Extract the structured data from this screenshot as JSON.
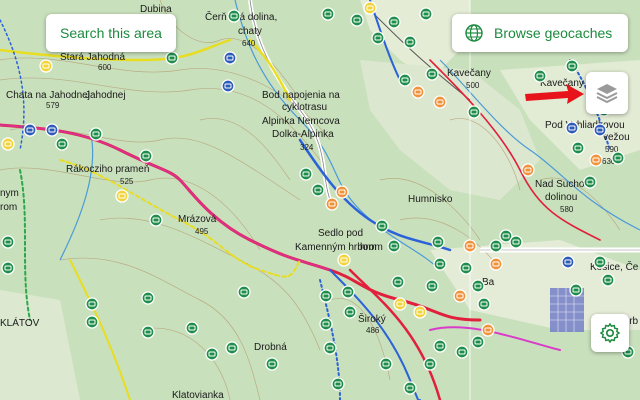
{
  "buttons": {
    "search_label": "Search this area",
    "browse_label": "Browse geocaches"
  },
  "icons": {
    "globe": "globe-icon",
    "layers": "layers-icon",
    "settings": "gear-icon",
    "arrow": "red-arrow-pointer"
  },
  "map": {
    "places": [
      {
        "text": "Dubina",
        "cls": "italic"
      },
      {
        "text": "Čerň   ská dolina,"
      },
      {
        "text": "chaty"
      },
      {
        "text": "Stará Jahodná"
      },
      {
        "text": "Chata na Jahodnej"
      },
      {
        "text": "Bod napojenia na"
      },
      {
        "text": "cyklotrasu"
      },
      {
        "text": "Alpinka Nemcova"
      },
      {
        "text": "Dolka-Alpinka"
      },
      {
        "text": "Kavečany"
      },
      {
        "text": "Kavečany",
        "cls": "italic"
      },
      {
        "text": "Pod Vyhliadkovou"
      },
      {
        "text": "vežou"
      },
      {
        "text": "Rákocziho prameň"
      },
      {
        "text": "Humnisko"
      },
      {
        "text": "Nad Suchou"
      },
      {
        "text": "dolinou"
      },
      {
        "text": "Mrázová"
      },
      {
        "text": "Sedlo pod"
      },
      {
        "text": "Kamenným hrbom"
      },
      {
        "text": "Košice, Če"
      },
      {
        "text": "Široký"
      },
      {
        "text": "Ba"
      },
      {
        "text": "KLÁTOV"
      },
      {
        "text": "Drobná",
        "cls": "italic"
      },
      {
        "text": "Klatovianka"
      },
      {
        "text": "Urb"
      },
      {
        "text": "Jahodnej"
      },
      {
        "text": "nym"
      },
      {
        "text": "rom"
      },
      {
        "text": "hrom"
      }
    ],
    "elevations": [
      "640",
      "600",
      "579",
      "525",
      "495",
      "324",
      "500",
      "580",
      "590",
      "486",
      "630"
    ],
    "colors": {
      "forest": "#c9e0bd",
      "meadow": "#e6eed8",
      "red_trail": "#e0203c",
      "blue_trail": "#2c62d8",
      "yellow_trail": "#e8dd20",
      "green_trail": "#2aa84a",
      "magenta_trail": "#d83cc8",
      "cache_traditional": "#1f8e4a",
      "cache_multi": "#f0923a",
      "cache_mystery": "#2d5bb8",
      "accent": "#1c8a3e",
      "arrow": "#e8141c"
    }
  }
}
